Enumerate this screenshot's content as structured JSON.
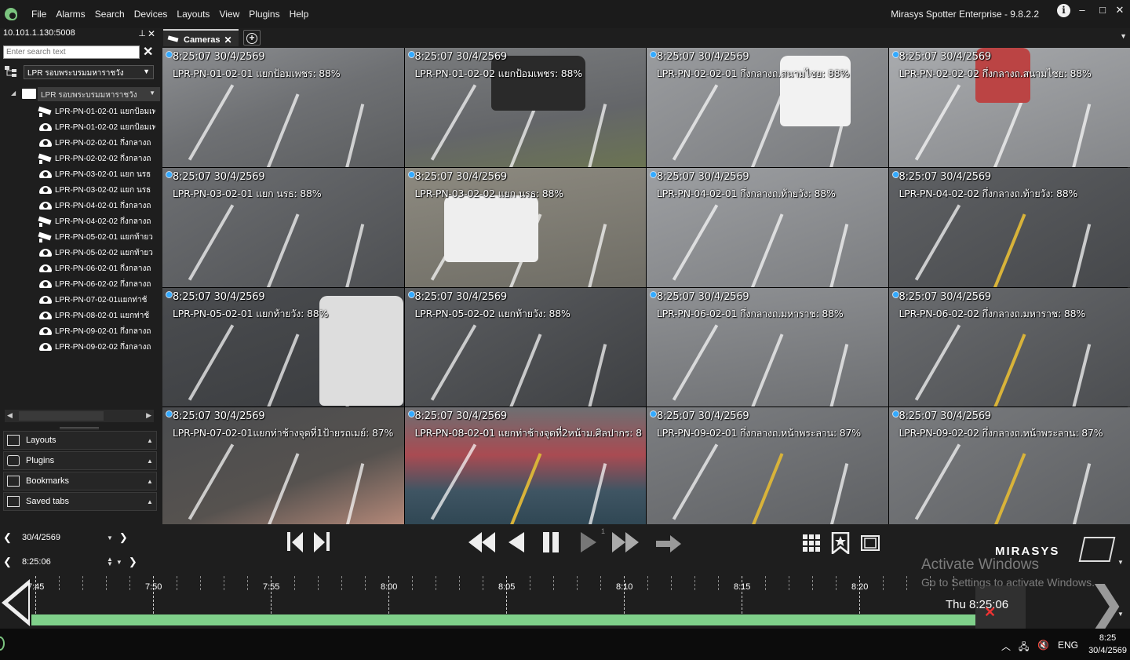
{
  "menu": [
    "File",
    "Alarms",
    "Search",
    "Devices",
    "Layouts",
    "View",
    "Plugins",
    "Help"
  ],
  "app_title": "Mirasys Spotter Enterprise - 9.8.2.2",
  "window_controls": {
    "minimize": "–",
    "maximize": "□",
    "close": "✕"
  },
  "left_panel": {
    "address": "10.101.1.130:5008",
    "search_placeholder": "Enter search text",
    "site_select": "LPR รอบพระบรมมหาราชวัง",
    "group_name": "LPR รอบพระบรมมหาราชวัง",
    "cameras": [
      {
        "label": "LPR-PN-01-02-01 แยกป้อมเพ",
        "icon": "bullet-camera-icon"
      },
      {
        "label": "LPR-PN-01-02-02 แยกป้อมเพ",
        "icon": "dome-camera-icon"
      },
      {
        "label": "LPR-PN-02-02-01 กึ่งกลางถ",
        "icon": "dome-camera-icon"
      },
      {
        "label": "LPR-PN-02-02-02 กึ่งกลางถ",
        "icon": "bullet-camera-icon"
      },
      {
        "label": "LPR-PN-03-02-01 แยก นรธ",
        "icon": "dome-camera-icon"
      },
      {
        "label": "LPR-PN-03-02-02 แยก นรธ",
        "icon": "dome-camera-icon"
      },
      {
        "label": "LPR-PN-04-02-01 กึ่งกลางถ",
        "icon": "dome-camera-icon"
      },
      {
        "label": "LPR-PN-04-02-02 กึ่งกลางถ",
        "icon": "bullet-camera-icon"
      },
      {
        "label": "LPR-PN-05-02-01 แยกท้ายว",
        "icon": "bullet-camera-icon"
      },
      {
        "label": "LPR-PN-05-02-02 แยกท้ายว",
        "icon": "dome-camera-icon"
      },
      {
        "label": "LPR-PN-06-02-01 กึ่งกลางถ",
        "icon": "dome-camera-icon"
      },
      {
        "label": "LPR-PN-06-02-02 กึ่งกลางถ",
        "icon": "dome-camera-icon"
      },
      {
        "label": "LPR-PN-07-02-01แยกท่าช้",
        "icon": "dome-camera-icon"
      },
      {
        "label": "LPR-PN-08-02-01 แยกท่าช้",
        "icon": "dome-camera-icon"
      },
      {
        "label": "LPR-PN-09-02-01 กึ่งกลางถ",
        "icon": "dome-camera-icon"
      },
      {
        "label": "LPR-PN-09-02-02 กึ่งกลางถ",
        "icon": "dome-camera-icon"
      }
    ],
    "accordion": [
      "Layouts",
      "Plugins",
      "Bookmarks",
      "Saved tabs"
    ]
  },
  "tab": {
    "label": "Cameras"
  },
  "tiles": [
    {
      "ts": "8:25:07  30/4/2569",
      "name": "LPR-PN-01-02-01 แยกป้อมเพชร: 88%"
    },
    {
      "ts": "8:25:07  30/4/2569",
      "name": "LPR-PN-01-02-02 แยกป้อมเพชร: 88%"
    },
    {
      "ts": "8:25:07  30/4/2569",
      "name": "LPR-PN-02-02-01 กึ่งกลางถ.สนามไชย: 88%"
    },
    {
      "ts": "8:25:07  30/4/2569",
      "name": "LPR-PN-02-02-02 กึ่งกลางถ.สนามไชย: 88%"
    },
    {
      "ts": "8:25:07  30/4/2569",
      "name": "LPR-PN-03-02-01 แยก นรธ: 88%"
    },
    {
      "ts": "8:25:07  30/4/2569",
      "name": "LPR-PN-03-02-02 แยก นรธ: 88%"
    },
    {
      "ts": "8:25:07  30/4/2569",
      "name": "LPR-PN-04-02-01 กึ่งกลางถ.ท้ายวัง: 88%"
    },
    {
      "ts": "8:25:07  30/4/2569",
      "name": "LPR-PN-04-02-02 กึ่งกลางถ.ท้ายวัง: 88%"
    },
    {
      "ts": "8:25:07  30/4/2569",
      "name": "LPR-PN-05-02-01 แยกท้ายวัง: 88%"
    },
    {
      "ts": "8:25:07  30/4/2569",
      "name": "LPR-PN-05-02-02 แยกท้ายวัง: 88%"
    },
    {
      "ts": "8:25:07  30/4/2569",
      "name": "LPR-PN-06-02-01 กึ่งกลางถ.มหาราช: 88%"
    },
    {
      "ts": "8:25:07  30/4/2569",
      "name": "LPR-PN-06-02-02 กึ่งกลางถ.มหาราช: 88%"
    },
    {
      "ts": "8:25:07  30/4/2569",
      "name": "LPR-PN-07-02-01แยกท่าช้างจุดที่1ป้ายรถเมย์: 87%"
    },
    {
      "ts": "8:25:07  30/4/2569",
      "name": "LPR-PN-08-02-01 แยกท่าช้างจุดที่2หน้าม.ศิลปากร: 8"
    },
    {
      "ts": "8:25:07  30/4/2569",
      "name": "LPR-PN-09-02-01 กึ่งกลางถ.หน้าพระลาน: 87%"
    },
    {
      "ts": "8:25:07  30/4/2569",
      "name": "LPR-PN-09-02-02 กึ่งกลางถ.หน้าพระลาน: 87%"
    }
  ],
  "controls": {
    "date": "30/4/2569",
    "time": "8:25:06",
    "speed_indicator": "1",
    "brand": "MIRASYS",
    "watermark_title": "Activate Windows",
    "watermark_sub": "Go to Settings to activate Windows.",
    "now_label": "Thu 8:25:06"
  },
  "timeline": {
    "labels": [
      "7:45",
      "7:50",
      "7:55",
      "8:00",
      "8:05",
      "8:10",
      "8:15",
      "8:20"
    ],
    "recorded_fraction": 0.97
  },
  "taskbar": {
    "lang": "ENG",
    "clock_time": "8:25",
    "clock_date": "30/4/2569"
  },
  "colors": {
    "accent_green": "#7fd08a",
    "status_dot": "#33aaff"
  }
}
